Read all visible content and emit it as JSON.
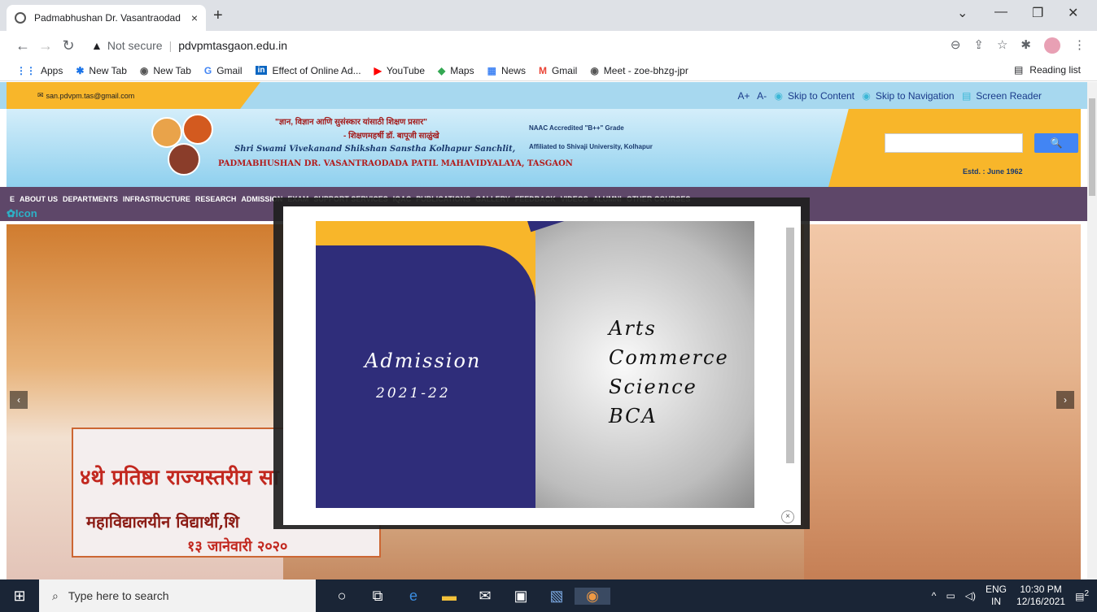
{
  "browser": {
    "tab_title": "Padmabhushan Dr. Vasantraodad",
    "tab_close": "×",
    "new_tab": "+",
    "win_min": "—",
    "win_restore": "❐",
    "win_close": "✕",
    "win_caret": "⌄",
    "security": "Not secure",
    "url": "pdvpmtasgaon.edu.in"
  },
  "bookmarks": [
    {
      "icon": "apps-icon",
      "label": "Apps"
    },
    {
      "icon": "gear-icon",
      "label": "New Tab"
    },
    {
      "icon": "globe-icon",
      "label": "New Tab"
    },
    {
      "icon": "google-icon",
      "label": "Gmail"
    },
    {
      "icon": "linkedin-icon",
      "label": "Effect of Online Ad..."
    },
    {
      "icon": "youtube-icon",
      "label": "YouTube"
    },
    {
      "icon": "maps-icon",
      "label": "Maps"
    },
    {
      "icon": "news-icon",
      "label": "News"
    },
    {
      "icon": "gmail-icon",
      "label": "Gmail"
    },
    {
      "icon": "globe-icon",
      "label": "Meet - zoe-bhzg-jpr"
    }
  ],
  "reading_list": "Reading list",
  "site": {
    "email": "san.pdvpm.tas@gmail.com",
    "access": {
      "font_plus": "A+",
      "font_minus": "A-",
      "skip_content": "Skip to Content",
      "skip_nav": "Skip to Navigation",
      "screen_reader": "Screen Reader"
    },
    "tagline1": "\"ज्ञान, विज्ञान आणि सुसंस्कार यांसाठी शिक्षण प्रसार\"",
    "tagline2": "- शिक्षणमहर्षी डॉ. बापूजी साळुंखे",
    "sanstha": "Shri Swami Vivekanand Shikshan Sanstha Kolhapur Sanchlit,",
    "college": "PADMABHUSHAN DR. VASANTRAODADA PATIL MAHAVIDYALAYA, TASGAON",
    "naac": "NAAC Accredited \"B++\" Grade",
    "affiliated": "Affiliated to Shivaji University, Kolhapur",
    "search_button": "🔍",
    "estd": "Estd. : June 1962",
    "menu": [
      "E",
      "ABOUT US",
      "DEPARTMENTS",
      "INFRASTRUCTURE",
      "RESEARCH",
      "ADMISSION",
      "EXAM",
      "SUPPORT SERVICES",
      "IQAC",
      "PUBLICATIONS",
      "GALLERY",
      "FEEDBACK",
      "VIDEOS",
      "ALUMNI",
      "OTHER COURSES"
    ],
    "icon_label": "Icon",
    "banner": {
      "line1": "४थे प्रतिष्ठा राज्यस्तरीय सा",
      "line2": "महाविद्यालयीन विद्यार्थी,शि",
      "line3": "१३ जानेवारी २०२०"
    },
    "prev": "‹",
    "next": "›"
  },
  "modal": {
    "admission": "Admission",
    "year": "2021-22",
    "courses": [
      "Arts",
      "Commerce",
      "Science",
      "BCA"
    ],
    "close": "×"
  },
  "taskbar": {
    "search_placeholder": "Type here to search",
    "lang1": "ENG",
    "lang2": "IN",
    "time": "10:30 PM",
    "date": "12/16/2021",
    "notif_count": "2"
  }
}
